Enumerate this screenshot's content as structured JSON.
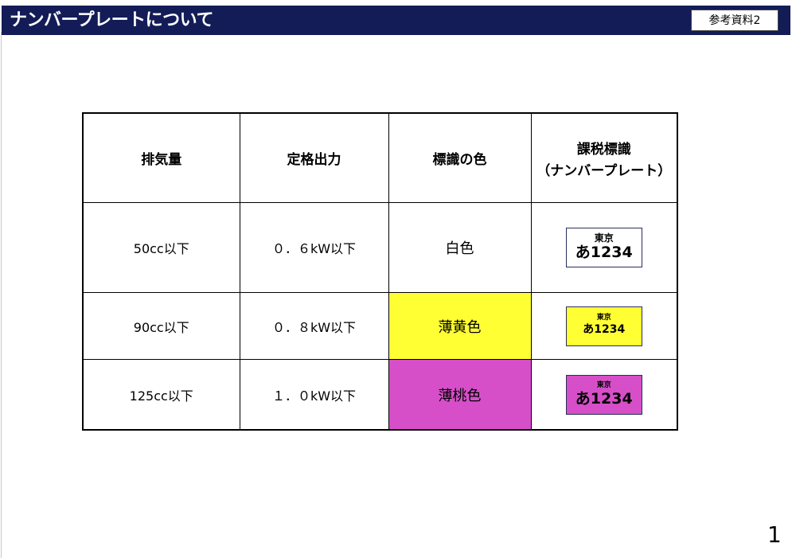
{
  "header": {
    "title": "ナンバープレートについて",
    "reference_label": "参考資料2",
    "background_color": "#131c57"
  },
  "table": {
    "columns": [
      {
        "label": "排気量"
      },
      {
        "label": "定格出力"
      },
      {
        "label": "標識の色"
      },
      {
        "label": "課税標識\n（ナンバープレート）",
        "line1": "課税標識",
        "line2": "（ナンバープレート）"
      }
    ],
    "rows": [
      {
        "displacement": "50cc以下",
        "rated_output": "０．６kW以下",
        "color_name": "白色",
        "color_hex": "#ffffff",
        "plate": {
          "prefecture": "東京",
          "number": "あ1234",
          "color": "#ffffff"
        }
      },
      {
        "displacement": "90cc以下",
        "rated_output": "０．８kW以下",
        "color_name": "薄黄色",
        "color_hex": "#ffff33",
        "plate": {
          "prefecture": "東京",
          "number": "あ1234",
          "color": "#ffff33"
        }
      },
      {
        "displacement": "125cc以下",
        "rated_output": "１．０kW以下",
        "color_name": "薄桃色",
        "color_hex": "#d64fc9",
        "plate": {
          "prefecture": "東京",
          "number": "あ1234",
          "color": "#d64fc9"
        }
      }
    ]
  },
  "page_number": "1"
}
